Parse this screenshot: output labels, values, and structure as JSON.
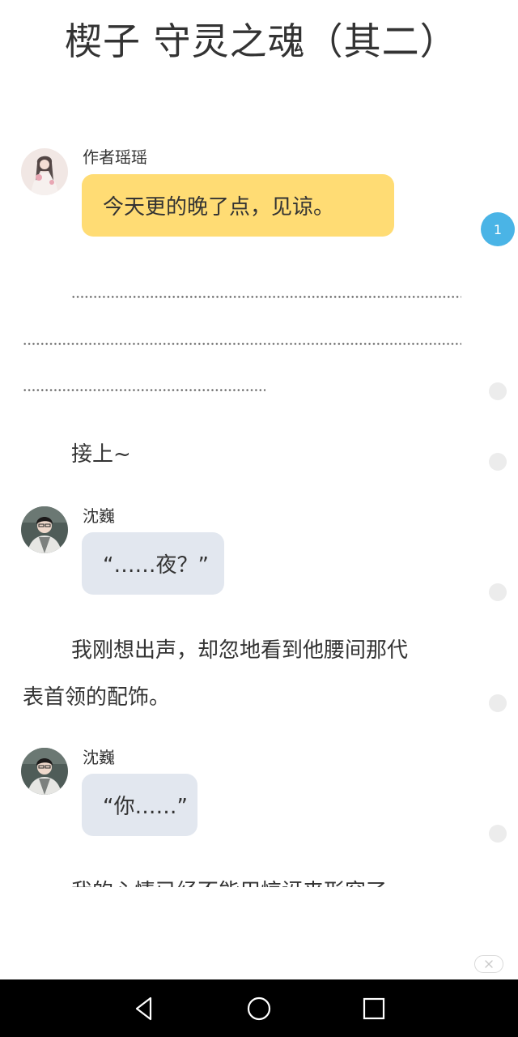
{
  "chapter": {
    "title": "楔子 守灵之魂（其二）"
  },
  "comment_badge": {
    "count": "1"
  },
  "messages": [
    {
      "speaker": "作者瑶瑶",
      "text": "今天更的晚了点，见谅。",
      "role": "author",
      "avatar": "author-avatar"
    },
    {
      "speaker": "沈巍",
      "text": "“……夜？”",
      "role": "character",
      "avatar": "shenwei-avatar"
    },
    {
      "speaker": "沈巍",
      "text": "“你……”",
      "role": "character",
      "avatar": "shenwei-avatar"
    }
  ],
  "paragraphs": {
    "continue": "接上~",
    "p1_line1": "我刚想出声，却忽地看到他腰间那代",
    "p1_line2": "表首领的配饰。",
    "p2_partial": "我的心情已经不能用惊讶来形容了"
  },
  "icons": {
    "nav_back": "triangle-back-icon",
    "nav_home": "circle-home-icon",
    "nav_recents": "square-recents-icon",
    "close": "close-icon"
  },
  "colors": {
    "author_bubble": "#ffdc74",
    "character_bubble": "#e2e7ef",
    "badge": "#4ab4e6",
    "navbar": "#000000"
  }
}
